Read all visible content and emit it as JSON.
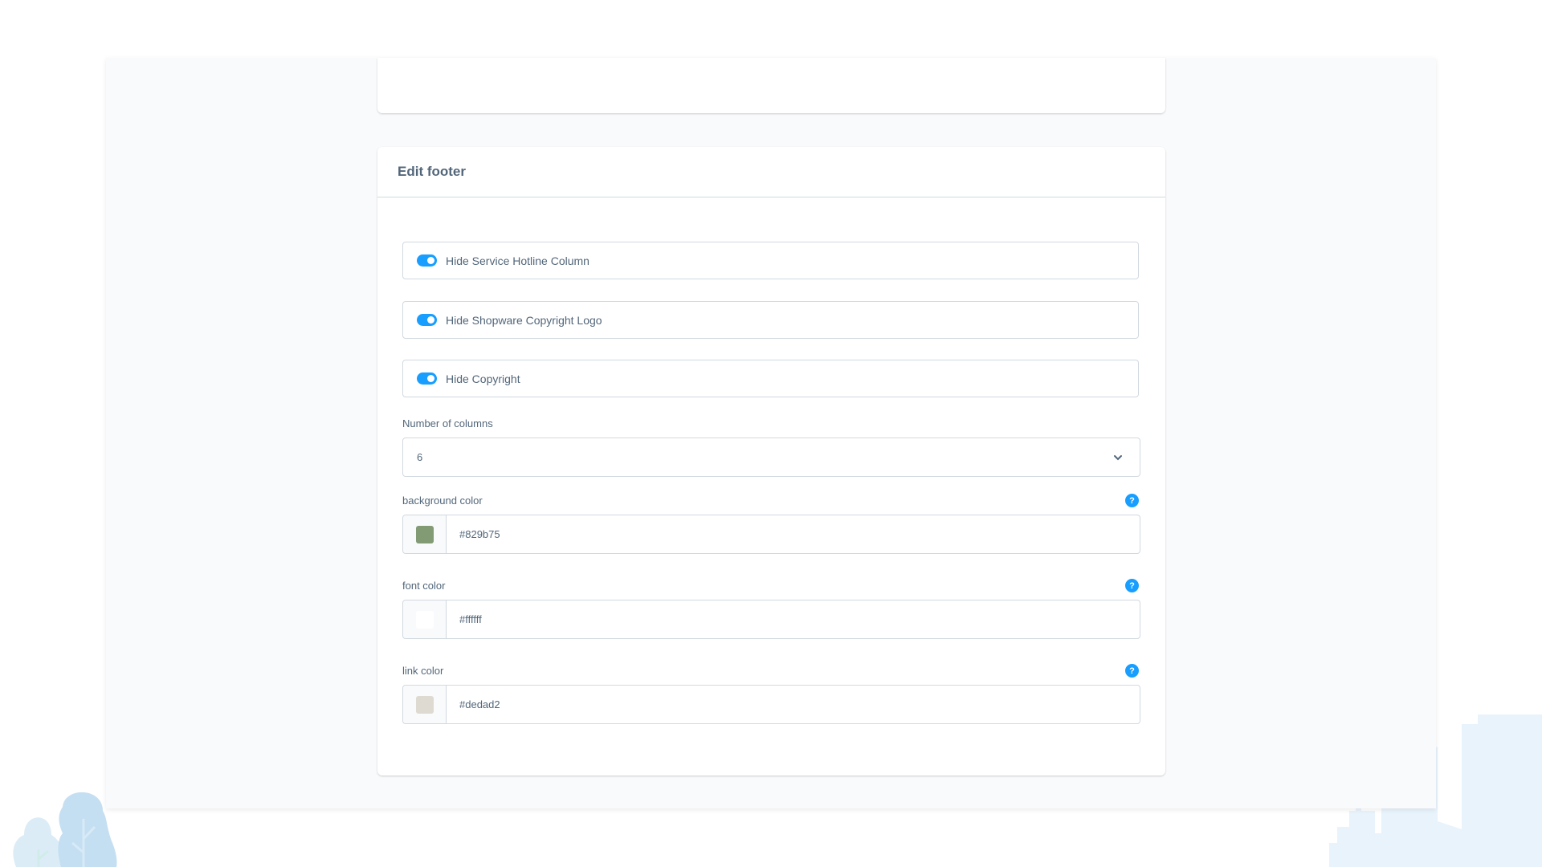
{
  "card_title": "Edit footer",
  "toggles": [
    {
      "label": "Hide Service Hotline Column",
      "checked": true
    },
    {
      "label": "Hide Shopware Copyright Logo",
      "checked": true
    },
    {
      "label": "Hide Copyright",
      "checked": true
    }
  ],
  "columns": {
    "label": "Number of columns",
    "value": "6"
  },
  "colors": [
    {
      "label": "background color",
      "value": "#829b75",
      "swatch": "#829b75"
    },
    {
      "label": "font color",
      "value": "#ffffff",
      "swatch": "#ffffff"
    },
    {
      "label": "link color",
      "value": "#dedad2",
      "swatch": "#dedad2"
    }
  ],
  "help_icon_glyph": "?",
  "accent_color": "#189eff"
}
